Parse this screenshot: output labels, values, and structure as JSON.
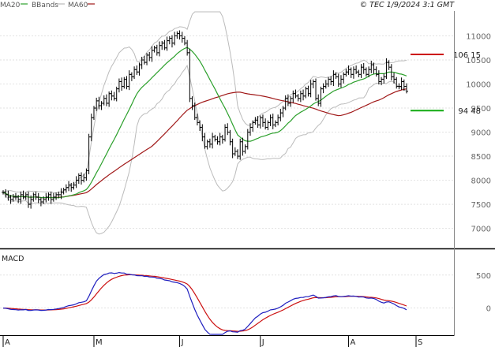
{
  "legend": {
    "ma20": {
      "label": "MA20",
      "color": "#2ca02c"
    },
    "bbands": {
      "label": "BBands",
      "color": "#bbbbbb"
    },
    "ma60": {
      "label": "MA60",
      "color": "#a01818"
    }
  },
  "header_right": "© TEC 1/9/2024 3:1 GMT",
  "macd_label": "MACD",
  "colors": {
    "price": "#000000",
    "grid": "#d8d8d8",
    "macd": "#1f1fbf",
    "signal": "#cc1111",
    "frame": "#000000"
  },
  "chart_data": [
    {
      "type": "ohlc",
      "title": "",
      "y_ticks": [
        7000,
        7500,
        8000,
        8500,
        9000,
        9500,
        10000,
        10500,
        11000
      ],
      "y_tick_labels": [
        "7000",
        "7500",
        "8000",
        "8500",
        "9000",
        "9500",
        "10000",
        "10500",
        "11000"
      ],
      "ylim": [
        6600,
        11500
      ],
      "x_labels": [
        "A",
        "M",
        "J",
        "J",
        "A",
        "S"
      ],
      "x_label_index": [
        0,
        36,
        70,
        102,
        137,
        172
      ],
      "annotations": [
        {
          "label": "106 15",
          "value": 10615,
          "color": "#cc0000"
        },
        {
          "label": "94 48",
          "value": 9448,
          "color": "#11aa11"
        }
      ],
      "close": [
        7750,
        7700,
        7650,
        7600,
        7650,
        7650,
        7600,
        7700,
        7650,
        7700,
        7500,
        7600,
        7700,
        7650,
        7600,
        7550,
        7600,
        7650,
        7700,
        7600,
        7650,
        7700,
        7700,
        7750,
        7800,
        7850,
        7900,
        7850,
        7900,
        8000,
        8100,
        8000,
        8050,
        8200,
        8900,
        9300,
        9500,
        9650,
        9550,
        9600,
        9700,
        9600,
        9800,
        9750,
        9700,
        9900,
        10050,
        9950,
        10100,
        9950,
        10200,
        10150,
        10300,
        10250,
        10400,
        10500,
        10450,
        10600,
        10550,
        10700,
        10750,
        10650,
        10800,
        10850,
        10750,
        10900,
        10950,
        10850,
        11000,
        11050,
        11000,
        10950,
        10850,
        10650,
        9700,
        9550,
        9300,
        9200,
        9100,
        8900,
        8700,
        8800,
        8750,
        8900,
        8850,
        8800,
        8900,
        8850,
        9100,
        9000,
        8800,
        8550,
        8600,
        8500,
        8800,
        8600,
        8700,
        9000,
        9100,
        9200,
        9250,
        9150,
        9300,
        9200,
        9100,
        9200,
        9300,
        9150,
        9200,
        9300,
        9400,
        9500,
        9700,
        9600,
        9700,
        9800,
        9750,
        9700,
        9800,
        9750,
        9900,
        9800,
        10000,
        10050,
        9700,
        9600,
        9900,
        9950,
        10000,
        10100,
        10050,
        10200,
        10150,
        10000,
        10100,
        10200,
        10250,
        10300,
        10200,
        10300,
        10250,
        10200,
        10350,
        10300,
        10200,
        10300,
        10400,
        10300,
        10200,
        10050,
        10100,
        10150,
        10450,
        10350,
        10150,
        10100,
        9950,
        9950,
        10050,
        9950,
        9850
      ]
    },
    {
      "type": "line",
      "series": [
        {
          "name": "MACD"
        },
        {
          "name": "signal"
        }
      ],
      "y_ticks": [
        0,
        500
      ],
      "y_tick_labels": [
        "0",
        "500"
      ],
      "ylim": [
        -400,
        820
      ]
    }
  ]
}
